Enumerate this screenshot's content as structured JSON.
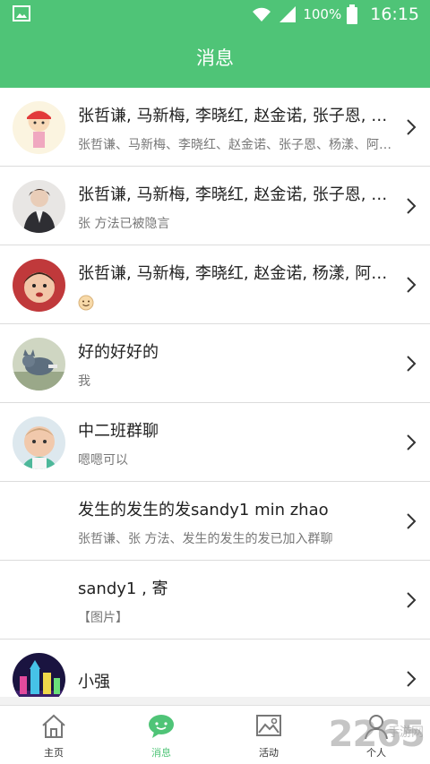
{
  "status_bar": {
    "battery": "100%",
    "time": "16:15"
  },
  "header": {
    "title": "消息"
  },
  "conversations": [
    {
      "title": "张哲谦, 马新梅, 李晓红, 赵金诺, 张子恩, 杨漾, 阿萨德, 张 方法",
      "subtitle": "张哲谦、马新梅、李晓红、赵金诺、张子恩、杨漾、阿萨德"
    },
    {
      "title": "张哲谦, 马新梅, 李晓红, 赵金诺, 张子恩, 杨漾, 阿萨德, 张 方法",
      "subtitle": "张 方法已被隐言"
    },
    {
      "title": "张哲谦, 马新梅, 李晓红, 赵金诺, 杨漾, 阿萨德",
      "subtitle": ""
    },
    {
      "title": "好的好好的",
      "subtitle": "我"
    },
    {
      "title": "中二班群聊",
      "subtitle": "嗯嗯可以"
    },
    {
      "title": "发生的发生的发sandy1 min zhao",
      "subtitle": "张哲谦、张 方法、发生的发生的发已加入群聊"
    },
    {
      "title": "sandy1 , 寄",
      "subtitle": "【图片】"
    },
    {
      "title": "小强",
      "subtitle": ""
    }
  ],
  "tabs": [
    {
      "label": "主页",
      "icon": "home-icon"
    },
    {
      "label": "消息",
      "icon": "chat-bubble-icon"
    },
    {
      "label": "活动",
      "icon": "picture-icon"
    },
    {
      "label": "个人",
      "icon": "person-icon"
    }
  ],
  "watermark": {
    "text": "2265",
    "sub": "手游网"
  },
  "colors": {
    "brand_green": "#4fc477"
  }
}
